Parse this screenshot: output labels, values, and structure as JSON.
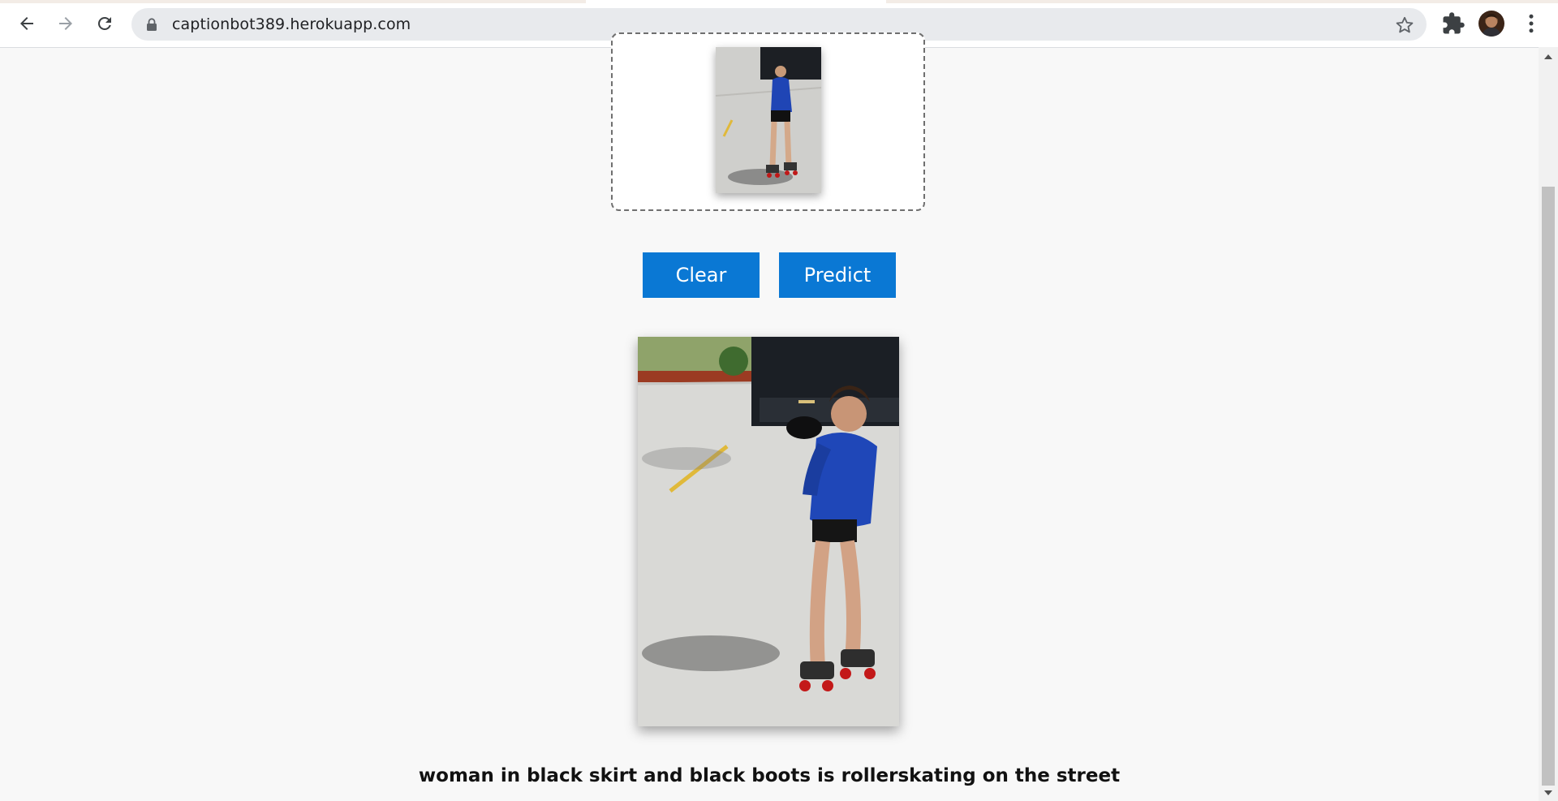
{
  "browser": {
    "url": "captionbot389.herokuapp.com",
    "icons": [
      "back-icon",
      "forward-icon",
      "reload-icon",
      "lock-icon",
      "star-icon",
      "extensions-icon",
      "avatar",
      "more-menu-icon"
    ]
  },
  "upload": {
    "preview_image": "uploaded-photo-thumbnail"
  },
  "actions": {
    "clear_label": "Clear",
    "predict_label": "Predict",
    "accent_color": "#0a78d4"
  },
  "result": {
    "image": "uploaded-photo-large",
    "caption": "woman in black skirt and black boots is rollerskating on the street"
  }
}
